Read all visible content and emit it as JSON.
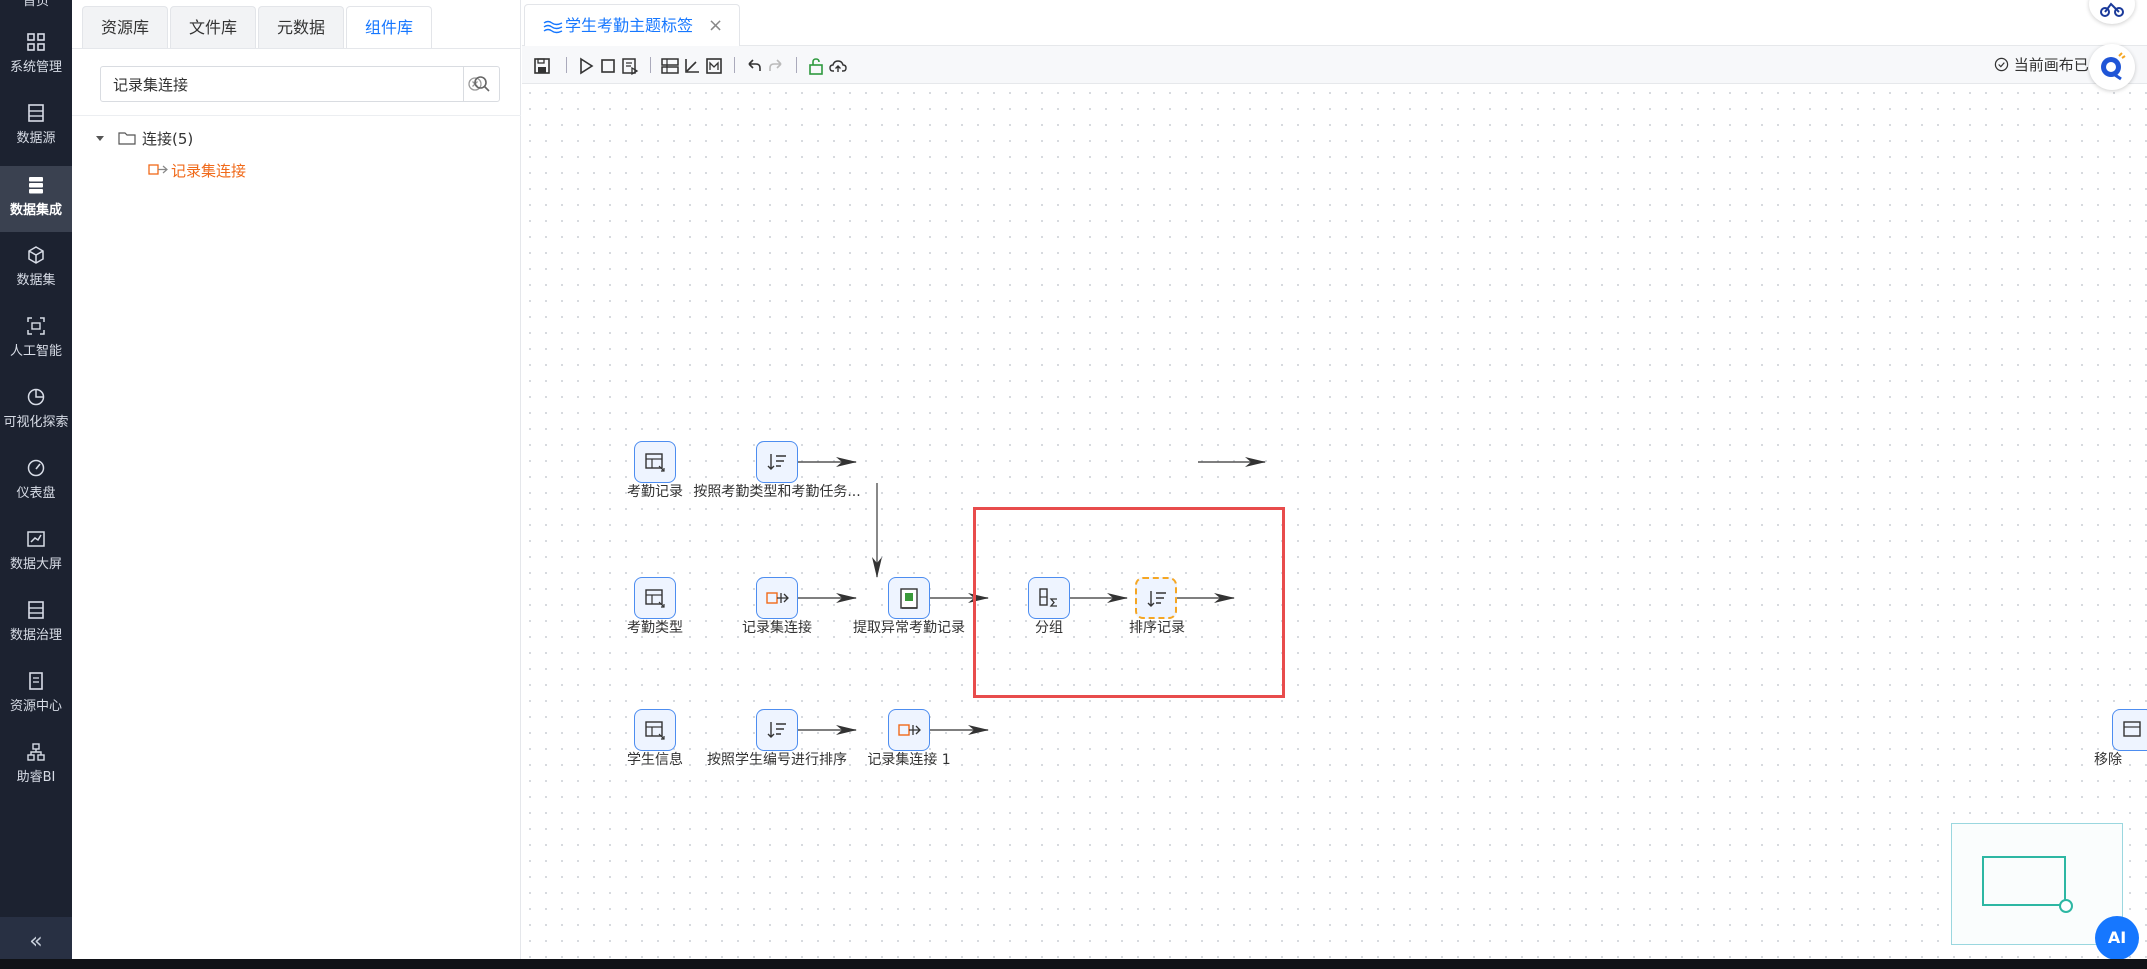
{
  "nav": {
    "items": [
      {
        "label": "首页"
      },
      {
        "label": "系统管理"
      },
      {
        "label": "数据源"
      },
      {
        "label": "数据集成"
      },
      {
        "label": "数据集"
      },
      {
        "label": "人工智能"
      },
      {
        "label": "可视化探索"
      },
      {
        "label": "仪表盘"
      },
      {
        "label": "数据大屏"
      },
      {
        "label": "数据治理"
      },
      {
        "label": "资源中心"
      },
      {
        "label": "助睿BI"
      }
    ],
    "active": "数据集成",
    "collapse": "«"
  },
  "panel": {
    "tabs": [
      {
        "label": "资源库"
      },
      {
        "label": "文件库"
      },
      {
        "label": "元数据"
      },
      {
        "label": "组件库"
      }
    ],
    "active_tab": "组件库",
    "search": {
      "value": "记录集连接",
      "placeholder": ""
    },
    "tree": {
      "folder": "连接(5)",
      "leaf": "记录集连接"
    }
  },
  "editor": {
    "tab_title": "学生考勤主题标签",
    "tab_close": "×",
    "canvas_status": "当前画布已"
  },
  "flow": {
    "nodes": [
      {
        "label": "考勤记录"
      },
      {
        "label": "按照考勤类型和考勤任务..."
      },
      {
        "label": "考勤类型"
      },
      {
        "label": "记录集连接"
      },
      {
        "label": "提取异常考勤记录"
      },
      {
        "label": "分组"
      },
      {
        "label": "排序记录"
      },
      {
        "label": "学生信息"
      },
      {
        "label": "按照学生编号进行排序"
      },
      {
        "label": "记录集连接 1"
      },
      {
        "label": "移除"
      }
    ]
  },
  "ai_button": "AI",
  "colors": {
    "accent": "#1677ff",
    "nav_bg": "#1c2230",
    "highlight": "#e84c4c",
    "tree_leaf": "#f06a1a",
    "selected_dash": "#f5a623"
  }
}
